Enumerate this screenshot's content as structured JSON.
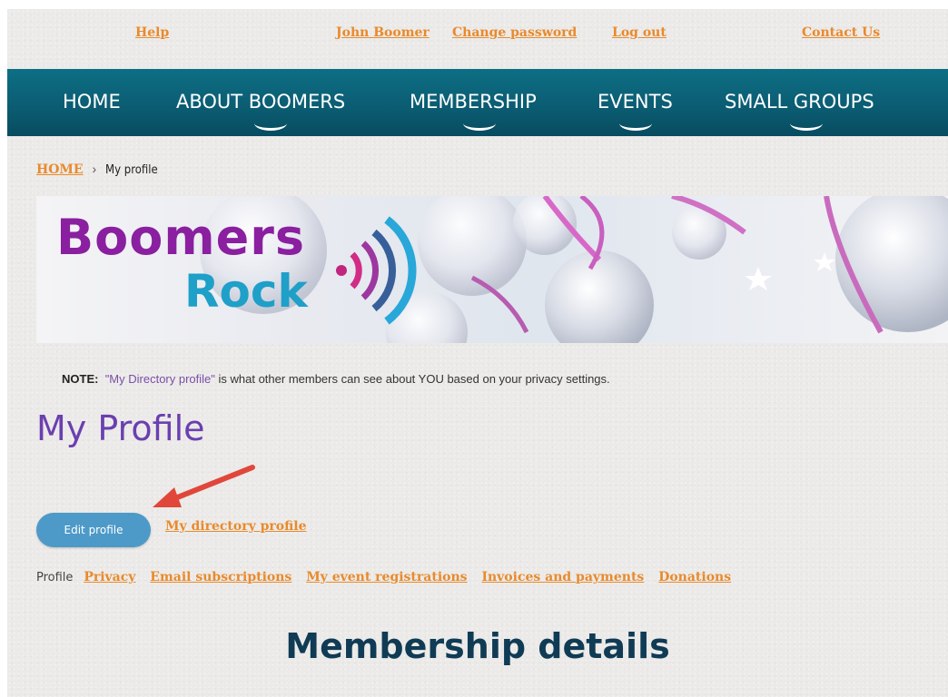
{
  "top_bar": {
    "help": "Help",
    "user_name": "John Boomer",
    "change_password": "Change password",
    "log_out": "Log out",
    "contact_us": "Contact Us"
  },
  "nav": {
    "items": [
      {
        "label": "HOME"
      },
      {
        "label": "ABOUT BOOMERS"
      },
      {
        "label": "MEMBERSHIP"
      },
      {
        "label": "EVENTS"
      },
      {
        "label": "SMALL GROUPS"
      }
    ]
  },
  "breadcrumb": {
    "home": "HOME",
    "separator": "›",
    "current": "My profile"
  },
  "banner": {
    "logo_line1": "Boomers",
    "logo_line2": "Rock"
  },
  "note": {
    "label": "NOTE:",
    "quote": "\"My Directory profile\"",
    "text": " is what other members can see about YOU based on your privacy settings."
  },
  "page_title": "My Profile",
  "actions": {
    "edit_profile": "Edit profile",
    "directory_profile": "My directory profile"
  },
  "profile_tabs": {
    "current": "Profile",
    "links": [
      "Privacy",
      "Email subscriptions",
      "My event registrations",
      "Invoices and payments",
      "Donations"
    ]
  },
  "section_title": "Membership details",
  "colors": {
    "link_orange": "#e98a2c",
    "nav_teal": "#0b5d73",
    "title_purple": "#6b3fb0",
    "button_blue": "#4d9ac9",
    "heading_navy": "#0f3b55",
    "arrow_red": "#e0473a"
  }
}
